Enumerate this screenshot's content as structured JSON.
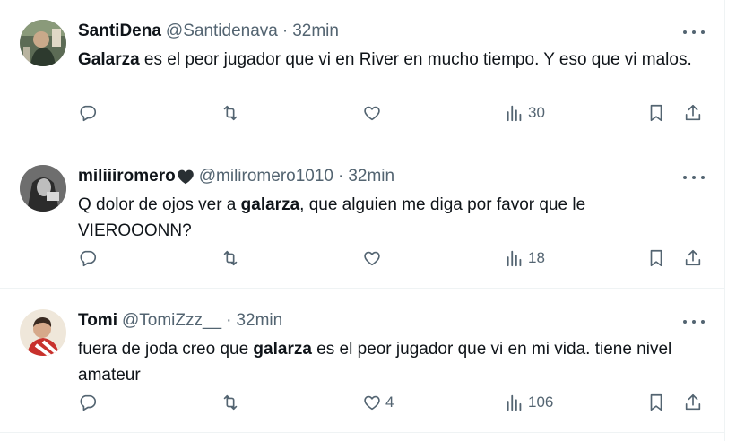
{
  "tweets": [
    {
      "name": "SantiDena",
      "handle": "@Santidenava",
      "separator": "·",
      "time": "32min",
      "text_parts": [
        "",
        "Galarza",
        " es el peor jugador que vi en River en mucho tiempo. Y eso que vi malos."
      ],
      "counts": {
        "reply": "",
        "retweet": "",
        "like": "",
        "views": "30"
      },
      "avatar_icon": "avatar-photo"
    },
    {
      "name": "miliiiromero",
      "name_emoji": "black-heart-icon",
      "handle": "@miliromero1010",
      "separator": "·",
      "time": "32min",
      "text_parts": [
        "Q dolor de ojos ver a ",
        "galarza",
        ", que alguien me diga por favor que le VIEROOONN?"
      ],
      "counts": {
        "reply": "",
        "retweet": "",
        "like": "",
        "views": "18"
      },
      "avatar_icon": "avatar-photo"
    },
    {
      "name": "Tomi",
      "handle": "@TomiZzz__",
      "separator": "·",
      "time": "32min",
      "text_parts": [
        "fuera de joda creo que ",
        "galarza",
        " es el peor jugador que vi en mi vida. tiene nivel amateur"
      ],
      "counts": {
        "reply": "",
        "retweet": "",
        "like": "4",
        "views": "106"
      },
      "avatar_icon": "avatar-photo"
    }
  ],
  "icons": [
    "reply-icon",
    "retweet-icon",
    "like-icon",
    "views-icon",
    "bookmark-icon",
    "share-icon",
    "more-icon"
  ],
  "colors": {
    "text": "#0f1419",
    "secondary": "#536471",
    "border": "#eff3f4"
  }
}
